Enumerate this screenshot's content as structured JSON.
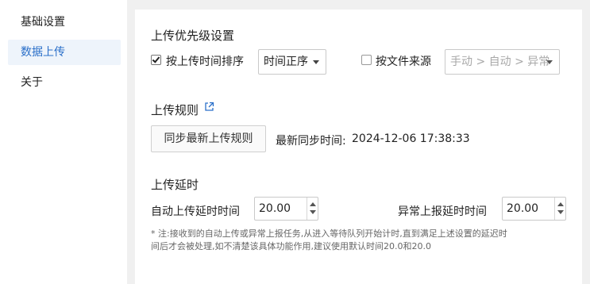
{
  "sidebar": {
    "items": [
      {
        "label": "基础设置"
      },
      {
        "label": "数据上传"
      },
      {
        "label": "关于"
      }
    ]
  },
  "priority": {
    "title": "上传优先级设置",
    "by_time": {
      "label": "按上传时间排序",
      "checked": true,
      "select_value": "时间正序"
    },
    "by_source": {
      "label": "按文件来源",
      "checked": false,
      "select_value": "手动 > 自动 > 异常"
    }
  },
  "rules": {
    "title": "上传规则",
    "sync_button": "同步最新上传规则",
    "last_sync_label": "最新同步时间:",
    "last_sync_time": "2024-12-06 17:38:33"
  },
  "delay": {
    "title": "上传延时",
    "auto_label": "自动上传延时时间",
    "auto_value": "20.00",
    "abnormal_label": "异常上报延时时间",
    "abnormal_value": "20.00",
    "note_line1": "* 注:接收到的自动上传或异常上报任务,从进入等待队列开始计时,直到满足上述设置的延迟时",
    "note_line2": "间后才会被处理,如不清楚该具体功能作用,建议使用默认时间20.0和20.0"
  },
  "colors": {
    "accent": "#2a6fc9",
    "active_bg": "#eef4fb"
  },
  "icons": {
    "external_link": "external-link-icon"
  }
}
